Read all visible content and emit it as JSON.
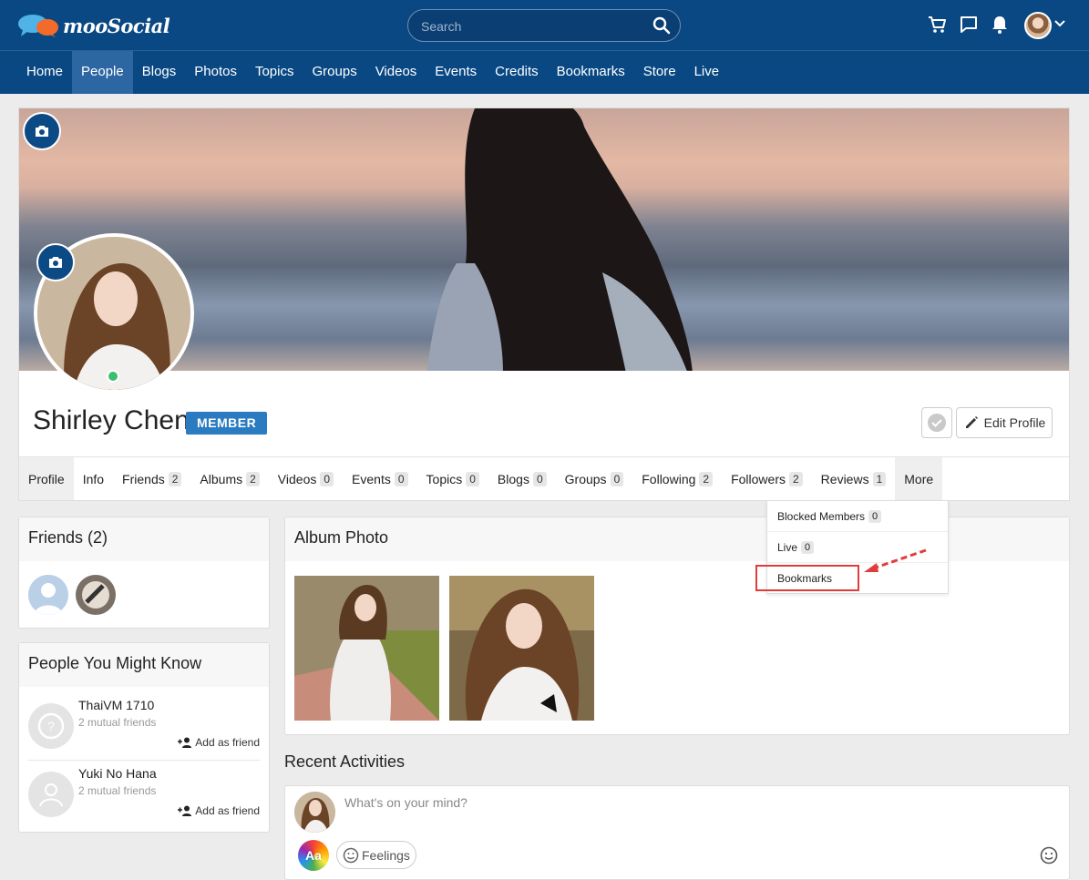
{
  "header": {
    "logo_text": "mooSocial",
    "search_placeholder": "Search"
  },
  "nav": [
    "Home",
    "People",
    "Blogs",
    "Photos",
    "Topics",
    "Groups",
    "Videos",
    "Events",
    "Credits",
    "Bookmarks",
    "Store",
    "Live"
  ],
  "nav_active": "People",
  "profile": {
    "name": "Shirley Chen",
    "badge": "MEMBER",
    "edit_label": "Edit Profile"
  },
  "tabs": [
    {
      "label": "Profile",
      "count": null
    },
    {
      "label": "Info",
      "count": null
    },
    {
      "label": "Friends",
      "count": "2"
    },
    {
      "label": "Albums",
      "count": "2"
    },
    {
      "label": "Videos",
      "count": "0"
    },
    {
      "label": "Events",
      "count": "0"
    },
    {
      "label": "Topics",
      "count": "0"
    },
    {
      "label": "Blogs",
      "count": "0"
    },
    {
      "label": "Groups",
      "count": "0"
    },
    {
      "label": "Following",
      "count": "2"
    },
    {
      "label": "Followers",
      "count": "2"
    },
    {
      "label": "Reviews",
      "count": "1"
    },
    {
      "label": "More",
      "count": null
    }
  ],
  "more_menu": [
    {
      "label": "Blocked Members",
      "count": "0"
    },
    {
      "label": "Live",
      "count": "0"
    },
    {
      "label": "Bookmarks",
      "count": null
    }
  ],
  "friends": {
    "title": "Friends (2)"
  },
  "pymk": {
    "title": "People You Might Know",
    "people": [
      {
        "name": "ThaiVM 1710",
        "mutual": "2 mutual friends",
        "action": "Add as friend"
      },
      {
        "name": "Yuki No Hana",
        "mutual": "2 mutual friends",
        "action": "Add as friend"
      }
    ]
  },
  "album": {
    "title": "Album Photo"
  },
  "recent": {
    "title": "Recent Activities",
    "composer_placeholder": "What's on your mind?",
    "aa_label": "Aa",
    "feelings_label": "Feelings"
  },
  "colors": {
    "header_bg": "#094883",
    "nav_active_bg": "#2c66a3",
    "badge_bg": "#2b7bc1",
    "highlight": "#e23b3b"
  }
}
